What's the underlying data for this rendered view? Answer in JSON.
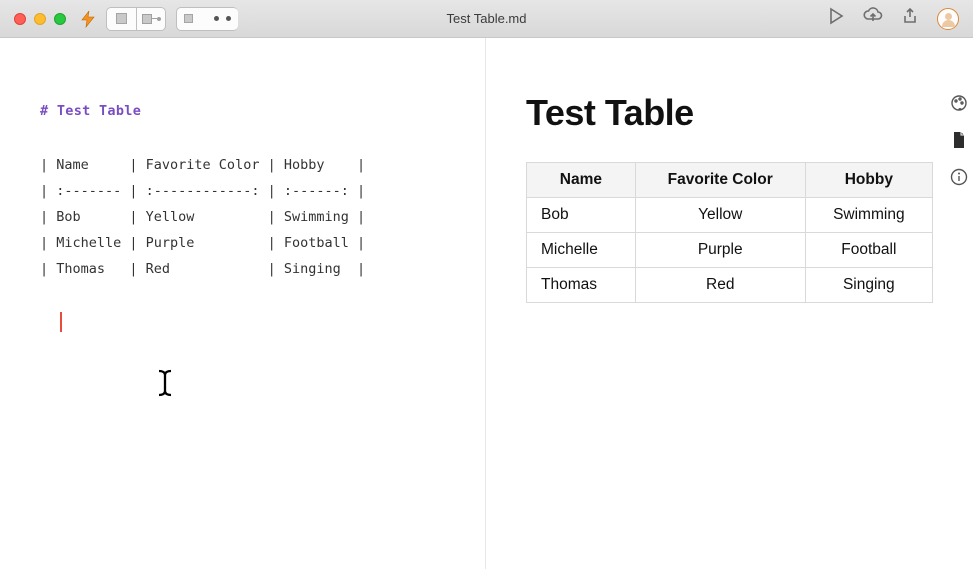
{
  "toolbar": {
    "file_title": "Test Table.md"
  },
  "editor": {
    "h1_line": "# Test Table",
    "row_header": "| Name     | Favorite Color | Hobby    |",
    "row_align": "| :------- | :------------: | :------: |",
    "row_1": "| Bob      | Yellow         | Swimming |",
    "row_2": "| Michelle | Purple         | Football |",
    "row_3": "| Thomas   | Red            | Singing  |"
  },
  "preview": {
    "title": "Test Table",
    "headers": {
      "c1": "Name",
      "c2": "Favorite Color",
      "c3": "Hobby"
    },
    "rows": [
      {
        "c1": "Bob",
        "c2": "Yellow",
        "c3": "Swimming"
      },
      {
        "c1": "Michelle",
        "c2": "Purple",
        "c3": "Football"
      },
      {
        "c1": "Thomas",
        "c2": "Red",
        "c3": "Singing"
      }
    ]
  },
  "chart_data": {
    "type": "table",
    "title": "Test Table",
    "columns": [
      "Name",
      "Favorite Color",
      "Hobby"
    ],
    "rows": [
      [
        "Bob",
        "Yellow",
        "Swimming"
      ],
      [
        "Michelle",
        "Purple",
        "Football"
      ],
      [
        "Thomas",
        "Red",
        "Singing"
      ]
    ]
  }
}
